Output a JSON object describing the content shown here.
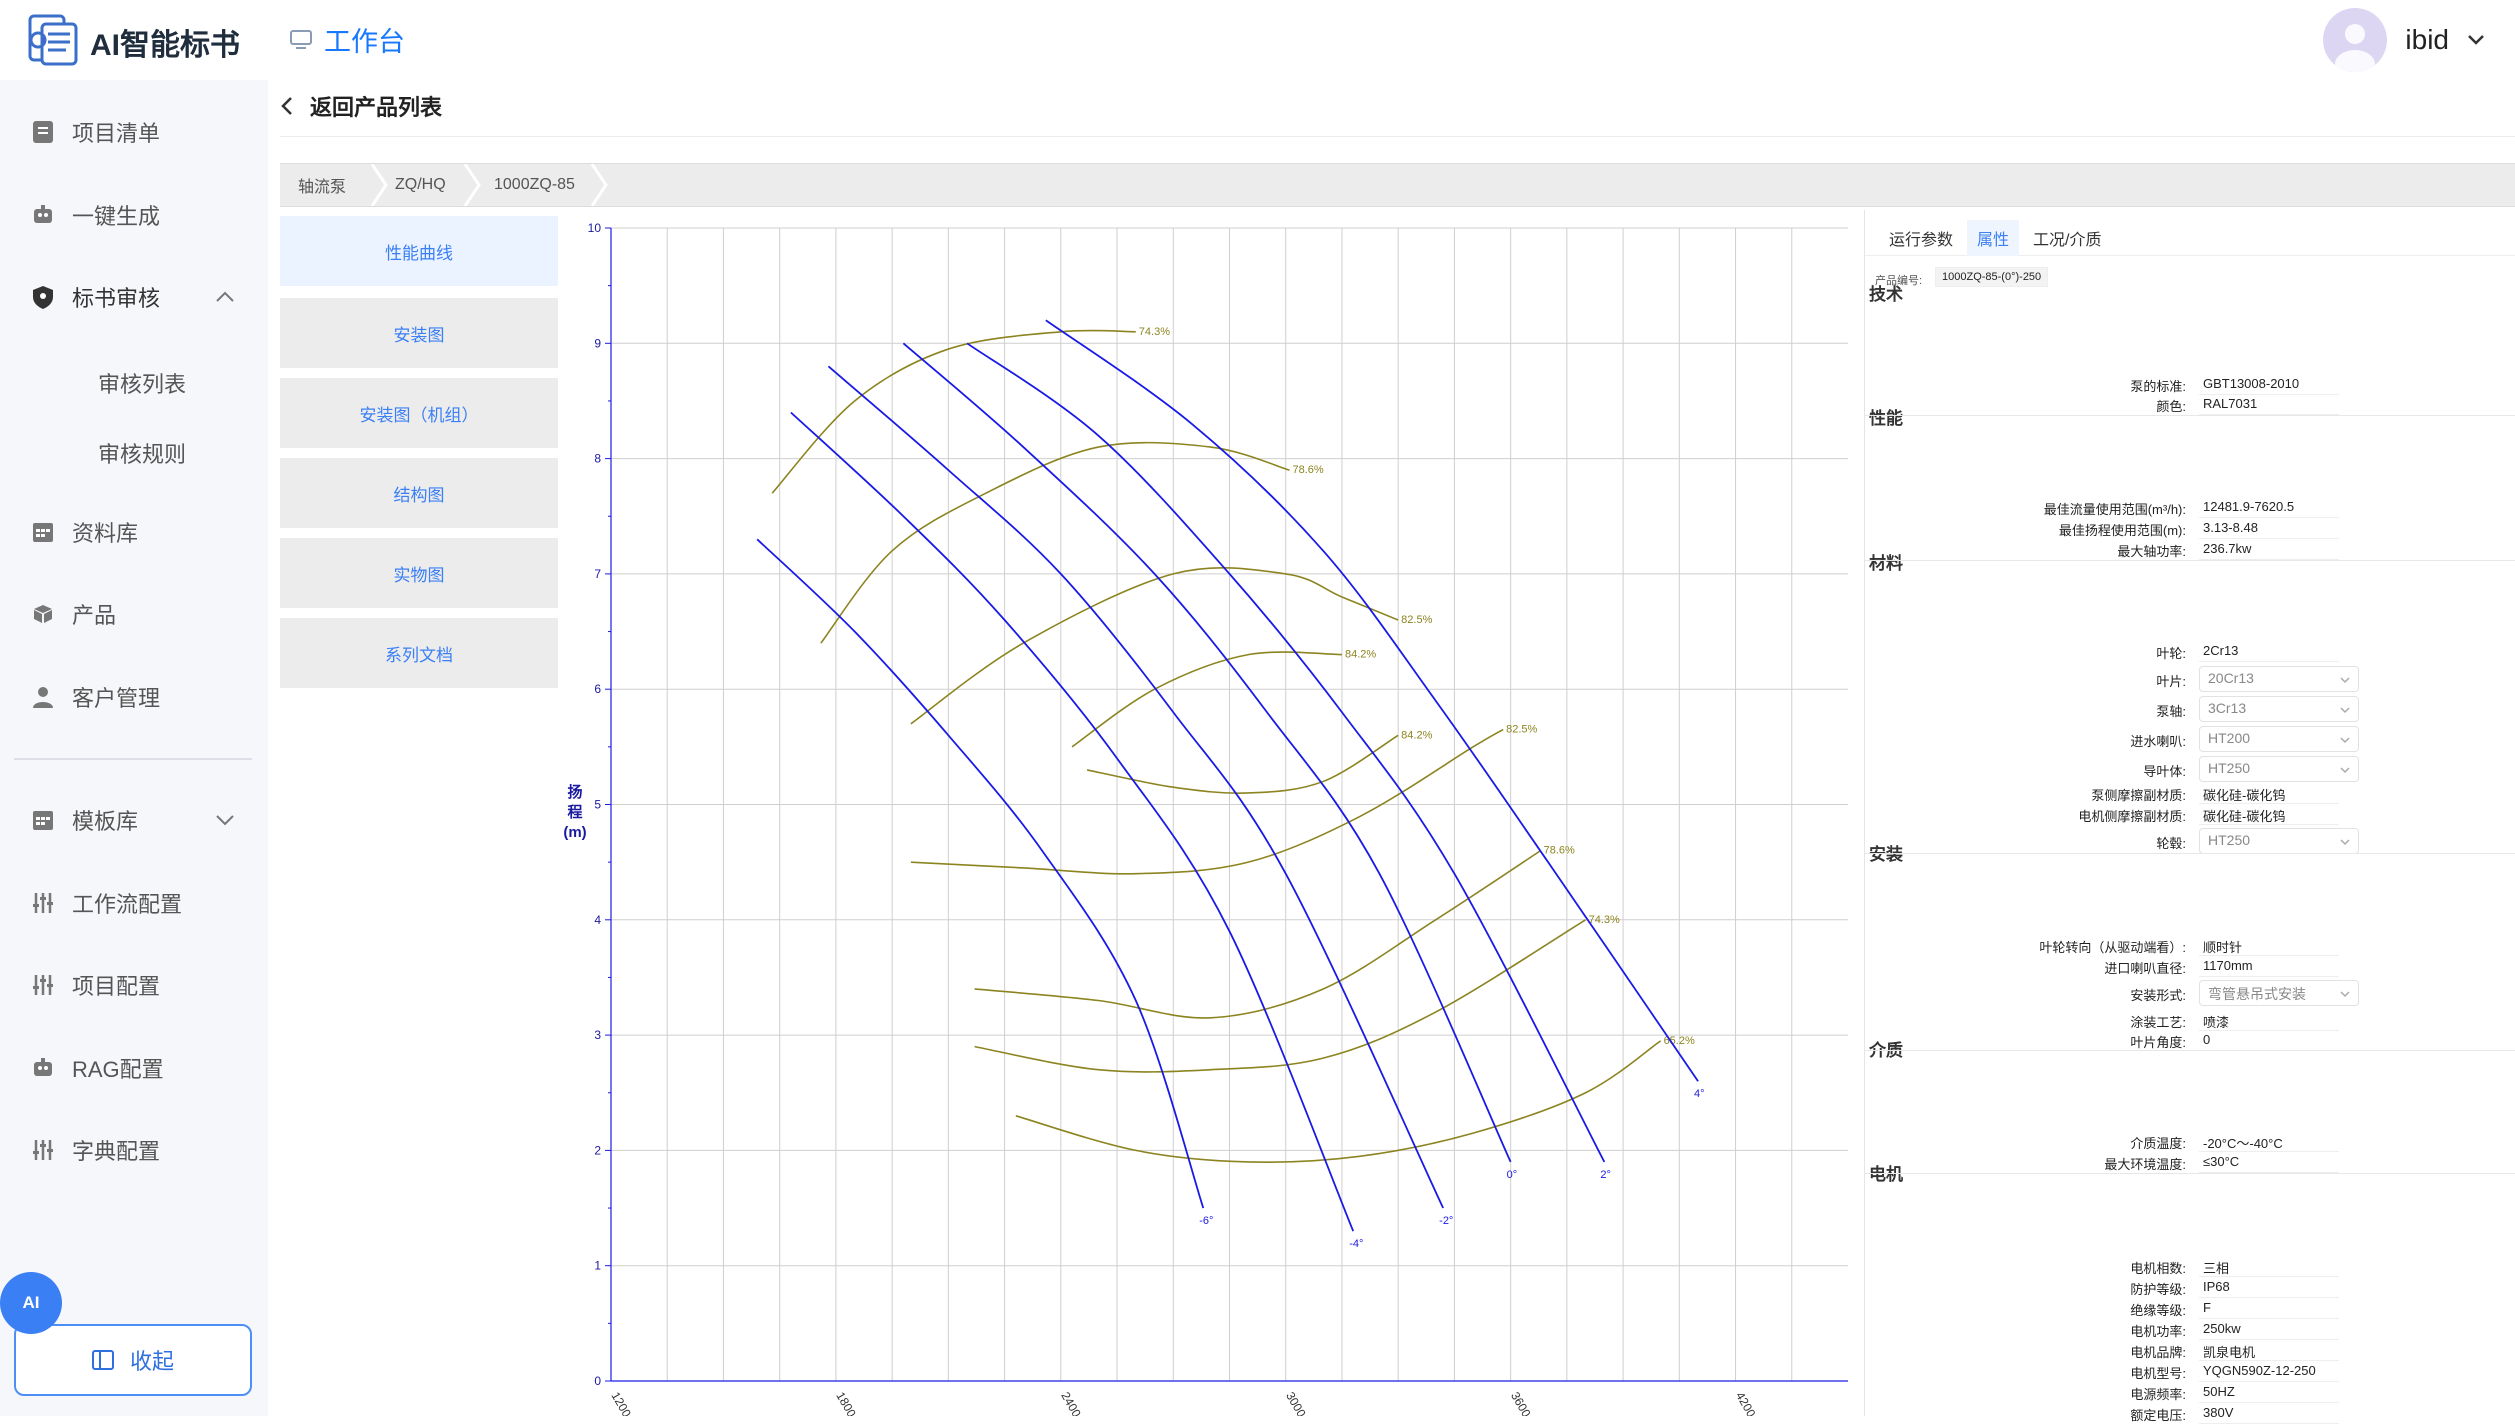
{
  "app": {
    "title": "AI智能标书",
    "workbench": "工作台"
  },
  "user": {
    "name": "ibid"
  },
  "sidebar": {
    "items": [
      {
        "label": "项目清单",
        "icon": "clipboard-icon"
      },
      {
        "label": "一键生成",
        "icon": "robot-icon"
      },
      {
        "label": "标书审核",
        "icon": "shield-icon"
      },
      {
        "label": "资料库",
        "icon": "calendar-grid-icon"
      },
      {
        "label": "产品",
        "icon": "box-icon"
      },
      {
        "label": "客户管理",
        "icon": "person-icon"
      },
      {
        "label": "模板库",
        "icon": "calendar-grid-icon"
      },
      {
        "label": "工作流配置",
        "icon": "sliders-icon"
      },
      {
        "label": "项目配置",
        "icon": "sliders-icon"
      },
      {
        "label": "RAG配置",
        "icon": "robot-icon"
      },
      {
        "label": "字典配置",
        "icon": "sliders-icon"
      }
    ],
    "sub_items": [
      "审核列表",
      "审核规则"
    ],
    "ai_badge": "AI",
    "collapse": "收起"
  },
  "back": {
    "label": "返回产品列表"
  },
  "breadcrumb": [
    "轴流泵",
    "ZQ/HQ",
    "1000ZQ-85"
  ],
  "side_tabs": [
    "性能曲线",
    "安装图",
    "安装图（机组）",
    "结构图",
    "实物图",
    "系列文档"
  ],
  "chart_data": {
    "type": "line",
    "title": "",
    "xlabel": "",
    "ylabel": "扬程(m)",
    "xlim": [
      1200,
      4500
    ],
    "ylim": [
      0,
      10
    ],
    "x_ticks": [
      1200,
      1800,
      2400,
      3000,
      3600,
      4200
    ],
    "y_ticks": [
      0,
      1,
      2,
      3,
      4,
      5,
      6,
      7,
      8,
      9,
      10
    ],
    "grid": true,
    "series": [
      {
        "name": "-6°",
        "x": [
          1590,
          1850,
          2100,
          2350,
          2600,
          2780
        ],
        "y": [
          7.3,
          6.5,
          5.6,
          4.6,
          3.3,
          1.5
        ]
      },
      {
        "name": "-4°",
        "x": [
          1680,
          1980,
          2250,
          2550,
          2850,
          3180
        ],
        "y": [
          8.4,
          7.5,
          6.6,
          5.4,
          3.9,
          1.3
        ]
      },
      {
        "name": "-2°",
        "x": [
          1780,
          2100,
          2400,
          2700,
          3000,
          3420
        ],
        "y": [
          8.8,
          7.9,
          7.0,
          5.8,
          4.4,
          1.5
        ]
      },
      {
        "name": "0°",
        "x": [
          1980,
          2300,
          2650,
          2950,
          3250,
          3600
        ],
        "y": [
          9.0,
          8.1,
          7.0,
          5.8,
          4.4,
          1.9
        ]
      },
      {
        "name": "2°",
        "x": [
          2150,
          2500,
          2850,
          3150,
          3450,
          3850
        ],
        "y": [
          9.0,
          8.2,
          7.0,
          5.8,
          4.4,
          1.9
        ]
      },
      {
        "name": "4°",
        "x": [
          2360,
          2750,
          3100,
          3400,
          3700,
          4100
        ],
        "y": [
          9.2,
          8.3,
          7.2,
          5.9,
          4.5,
          2.6
        ]
      }
    ],
    "efficiency_contours": [
      {
        "label": "74.3%",
        "x": [
          1630,
          1850,
          2100,
          2400,
          2600
        ],
        "y": [
          7.7,
          8.5,
          8.95,
          9.1,
          9.1
        ]
      },
      {
        "label": "78.6%",
        "x": [
          1760,
          1950,
          2200,
          2500,
          2800,
          3010
        ],
        "y": [
          6.4,
          7.2,
          7.7,
          8.1,
          8.1,
          7.9
        ]
      },
      {
        "label": "82.5%",
        "x": [
          2000,
          2300,
          2700,
          3000,
          3150,
          3300
        ],
        "y": [
          5.7,
          6.4,
          7.0,
          7.0,
          6.8,
          6.6
        ]
      },
      {
        "label": "84.2%",
        "x": [
          2430,
          2650,
          2900,
          3150
        ],
        "y": [
          5.5,
          6.0,
          6.3,
          6.3
        ]
      },
      {
        "label": "84.2%",
        "x": [
          2470,
          2700,
          2900,
          3100,
          3300
        ],
        "y": [
          5.3,
          5.15,
          5.1,
          5.2,
          5.6
        ]
      },
      {
        "label": "82.5%",
        "x": [
          2000,
          2300,
          2600,
          2900,
          3200,
          3500,
          3580
        ],
        "y": [
          4.5,
          4.45,
          4.4,
          4.5,
          4.9,
          5.5,
          5.65
        ]
      },
      {
        "label": "78.6%",
        "x": [
          2170,
          2500,
          2800,
          3100,
          3400,
          3680
        ],
        "y": [
          3.4,
          3.3,
          3.15,
          3.4,
          4.0,
          4.6
        ]
      },
      {
        "label": "74.3%",
        "x": [
          2170,
          2500,
          2800,
          3100,
          3400,
          3800
        ],
        "y": [
          2.9,
          2.7,
          2.7,
          2.8,
          3.2,
          4.0
        ]
      },
      {
        "label": "65.2%",
        "x": [
          2280,
          2600,
          2900,
          3200,
          3500,
          3800,
          4000
        ],
        "y": [
          2.3,
          2.0,
          1.9,
          1.95,
          2.15,
          2.5,
          2.95
        ]
      }
    ]
  },
  "right_panel": {
    "tabs": [
      "运行参数",
      "属性",
      "工况/介质"
    ],
    "active_tab": "属性",
    "product_code_label": "产品编号:",
    "product_code": "1000ZQ-85-(0°)-250",
    "sections": [
      {
        "title": "技术",
        "rows": [
          {
            "label": "泵的标准:",
            "value": "GBT13008-2010"
          },
          {
            "label": "颜色:",
            "value": "RAL7031"
          }
        ]
      },
      {
        "title": "性能",
        "rows": [
          {
            "label": "最佳流量使用范围(m³/h):",
            "value": "12481.9-7620.5"
          },
          {
            "label": "最佳扬程使用范围(m):",
            "value": "3.13-8.48"
          },
          {
            "label": "最大轴功率:",
            "value": "236.7kw"
          }
        ]
      },
      {
        "title": "材料",
        "rows": [
          {
            "label": "叶轮:",
            "value": "2Cr13"
          },
          {
            "label": "叶片:",
            "value": "20Cr13",
            "select": true
          },
          {
            "label": "泵轴:",
            "value": "3Cr13",
            "select": true
          },
          {
            "label": "进水喇叭:",
            "value": "HT200",
            "select": true
          },
          {
            "label": "导叶体:",
            "value": "HT250",
            "select": true
          },
          {
            "label": "泵侧摩擦副材质:",
            "value": "碳化硅-碳化钨"
          },
          {
            "label": "电机侧摩擦副材质:",
            "value": "碳化硅-碳化钨"
          },
          {
            "label": "轮毂:",
            "value": "HT250",
            "select": true
          }
        ]
      },
      {
        "title": "安装",
        "rows": [
          {
            "label": "叶轮转向（从驱动端看）:",
            "value": "顺时针"
          },
          {
            "label": "进口喇叭直径:",
            "value": "1170mm"
          },
          {
            "label": "安装形式:",
            "value": "弯管悬吊式安装",
            "select": true
          },
          {
            "label": "涂装工艺:",
            "value": "喷漆"
          },
          {
            "label": "叶片角度:",
            "value": "0"
          }
        ]
      },
      {
        "title": "介质",
        "rows": [
          {
            "label": "介质温度:",
            "value": "-20°C〜-40°C"
          },
          {
            "label": "最大环境温度:",
            "value": "≤30°C"
          }
        ]
      },
      {
        "title": "电机",
        "rows": [
          {
            "label": "电机相数:",
            "value": "三相"
          },
          {
            "label": "防护等级:",
            "value": "IP68"
          },
          {
            "label": "绝缘等级:",
            "value": "F"
          },
          {
            "label": "电机功率:",
            "value": "250kw"
          },
          {
            "label": "电机品牌:",
            "value": "凯泉电机"
          },
          {
            "label": "电机型号:",
            "value": "YQGN590Z-12-250"
          },
          {
            "label": "电源频率:",
            "value": "50HZ"
          },
          {
            "label": "额定电压:",
            "value": "380V"
          }
        ]
      }
    ]
  },
  "colors": {
    "accent": "#3b7ff5",
    "curve": "#1a1ae6",
    "contour": "#8c8420"
  }
}
